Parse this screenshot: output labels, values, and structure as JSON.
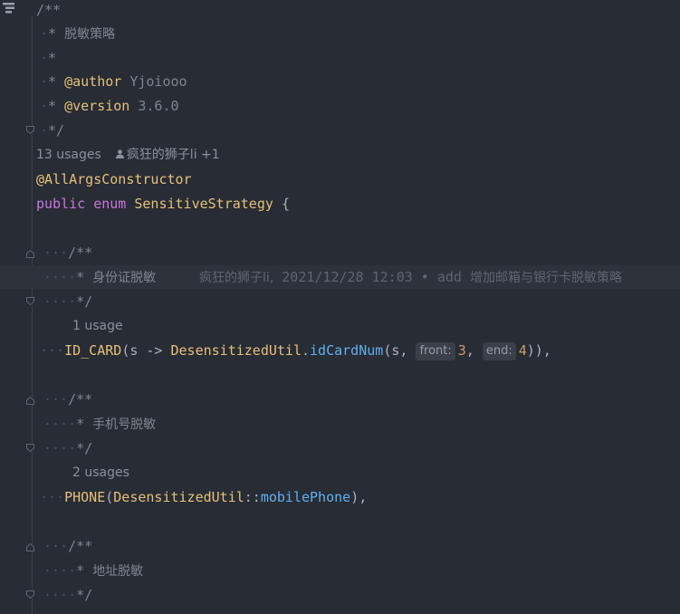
{
  "colors": {
    "background": "#282c34",
    "comment": "#7f848e",
    "keyword": "#c678dd",
    "annotation": "#e5c07b",
    "method": "#61afef",
    "number": "#d19a66",
    "hint_background": "#3b4048"
  },
  "doc_comment": {
    "open": "/**",
    "star": "*",
    "title": "脱敏策略",
    "author_tag": "@author",
    "author_value": "Yjoiooo",
    "version_tag": "@version",
    "version_value": "3.6.0",
    "close": "*/"
  },
  "class_header": {
    "usages": "13 usages",
    "author": "疯狂的狮子li +1",
    "annotation": "@AllArgsConstructor",
    "modifier": "public",
    "keyword": "enum",
    "name": "SensitiveStrategy",
    "brace": "{"
  },
  "entries": [
    {
      "comment_open": "/**",
      "comment_star": "*",
      "comment_text": "身份证脱敏",
      "blame_author": "疯狂的狮子li,",
      "blame_time": "2021/12/28 12:03",
      "blame_sep": "•",
      "blame_action": "add",
      "blame_message": "增加邮箱与银行卡脱敏策略",
      "comment_close": "*/",
      "usages": "1 usage",
      "name": "ID_CARD",
      "code_start": "(s -> ",
      "class_ref": "DesensitizedUtil",
      "dot": ".",
      "method": "idCardNum",
      "arg_open": "(s, ",
      "hint1": "front:",
      "val1": "3",
      "comma": ", ",
      "hint2": "end:",
      "val2": "4",
      "code_end": ")),"
    },
    {
      "comment_open": "/**",
      "comment_star": "*",
      "comment_text": "手机号脱敏",
      "comment_close": "*/",
      "usages": "2 usages",
      "name": "PHONE",
      "paren": "(",
      "class_ref": "DesensitizedUtil",
      "ref_sep": "::",
      "method": "mobilePhone",
      "code_end": "),"
    },
    {
      "comment_open": "/**",
      "comment_star": "*",
      "comment_text": "地址脱敏",
      "comment_close": "*/"
    }
  ]
}
